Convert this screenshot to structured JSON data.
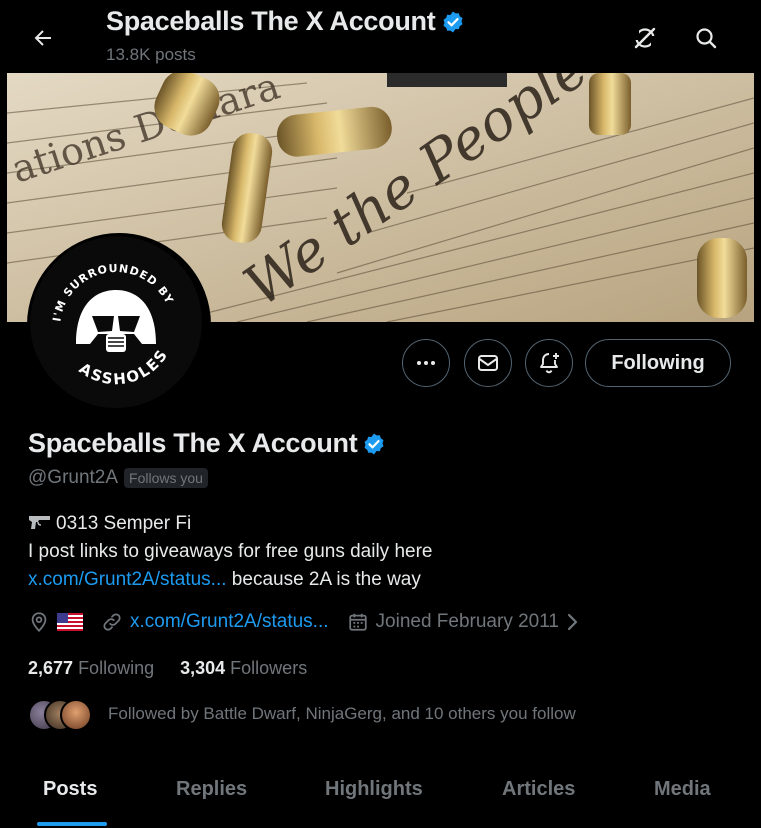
{
  "header": {
    "title": "Spaceballs The X Account",
    "post_count": "13.8K posts"
  },
  "profile": {
    "name": "Spaceballs The X Account",
    "handle": "@Grunt2A",
    "follows_you_badge": "Follows you",
    "avatar_text_top": "I'M SURROUNDED BY",
    "avatar_text_bottom": "ASSHOLES",
    "bio_line1": "0313 Semper Fi",
    "bio_line2": "I post links to giveaways for free guns daily here",
    "bio_link": "x.com/Grunt2A/status...",
    "bio_line3_rest": " because 2A is the way",
    "location_flag": "🇺🇸",
    "website": "x.com/Grunt2A/status...",
    "joined": "Joined February 2011",
    "following_count": "2,677",
    "following_label": "Following",
    "followers_count": "3,304",
    "followers_label": "Followers",
    "followed_by": "Followed by Battle Dwarf, NinjaGerg, and 10 others you follow"
  },
  "actions": {
    "more_label": "···",
    "following_button": "Following"
  },
  "tabs": [
    {
      "label": "Posts",
      "active": true
    },
    {
      "label": "Replies",
      "active": false
    },
    {
      "label": "Highlights",
      "active": false
    },
    {
      "label": "Articles",
      "active": false
    },
    {
      "label": "Media",
      "active": false
    }
  ],
  "colors": {
    "accent": "#1d9bf0",
    "text_primary": "#e7e9ea",
    "text_secondary": "#71767b",
    "background": "#000000",
    "border": "#536471"
  },
  "icons": [
    "back-arrow-icon",
    "verified-badge-icon",
    "grok-icon",
    "search-icon",
    "more-icon",
    "message-icon",
    "notification-bell-icon",
    "location-icon",
    "link-icon",
    "calendar-icon",
    "chevron-right-icon",
    "pistol-icon"
  ]
}
